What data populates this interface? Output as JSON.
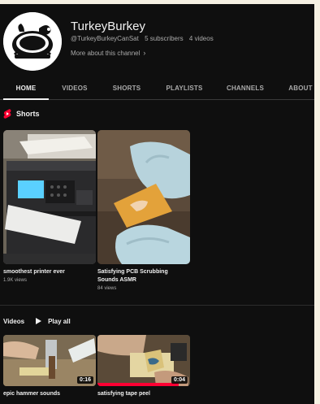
{
  "channel": {
    "name": "TurkeyBurkey",
    "handle": "@TurkeyBurkeyCanSat",
    "subscribers": "5 subscribers",
    "videos_count": "4 videos",
    "about_link": "More about this channel"
  },
  "tabs": [
    {
      "label": "HOME",
      "active": true
    },
    {
      "label": "VIDEOS",
      "active": false
    },
    {
      "label": "SHORTS",
      "active": false
    },
    {
      "label": "PLAYLISTS",
      "active": false
    },
    {
      "label": "CHANNELS",
      "active": false
    },
    {
      "label": "ABOUT",
      "active": false
    }
  ],
  "shorts_section": {
    "title": "Shorts",
    "items": [
      {
        "title": "smoothest printer ever",
        "views": "1.9K views"
      },
      {
        "title": "Satisfying PCB Scrubbing Sounds ASMR",
        "views": "84 views"
      }
    ]
  },
  "videos_section": {
    "title": "Videos",
    "play_all": "Play all",
    "items": [
      {
        "title": "epic hammer sounds",
        "duration": "0:16"
      },
      {
        "title": "satisfying tape peel",
        "duration": "0:04"
      }
    ]
  },
  "colors": {
    "background": "#0f0f0f",
    "page": "#f6f1e3",
    "text": "#f1f1f1",
    "muted": "#aaaaaa",
    "shorts_red": "#ff0033"
  }
}
